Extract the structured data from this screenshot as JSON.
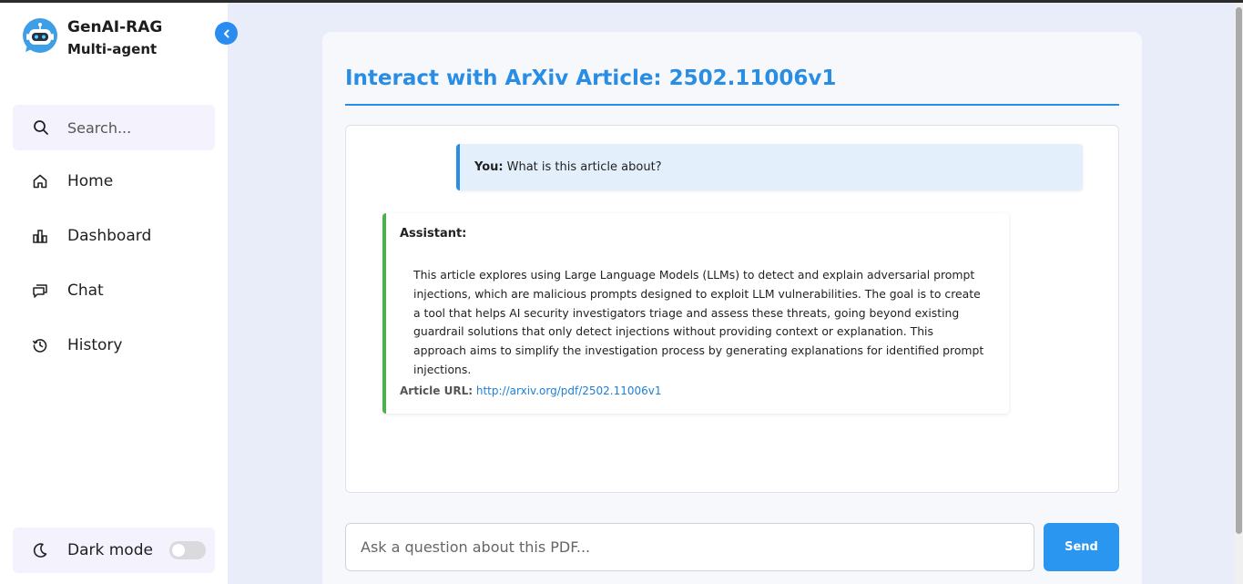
{
  "brand": {
    "name": "GenAI-RAG",
    "subtitle": "Multi-agent"
  },
  "search": {
    "placeholder": "Search..."
  },
  "nav": {
    "items": [
      {
        "label": "Home",
        "icon": "home-icon"
      },
      {
        "label": "Dashboard",
        "icon": "bar-chart-icon"
      },
      {
        "label": "Chat",
        "icon": "chat-icon"
      },
      {
        "label": "History",
        "icon": "history-icon"
      }
    ]
  },
  "darkmode": {
    "label": "Dark mode",
    "enabled": false
  },
  "main": {
    "title": "Interact with ArXiv Article: 2502.11006v1",
    "user_message": {
      "speaker": "You:",
      "text": "What is this article about?"
    },
    "assistant_message": {
      "speaker": "Assistant:",
      "text": "This article explores using Large Language Models (LLMs) to detect and explain adversarial prompt injections, which are malicious prompts designed to exploit LLM vulnerabilities.  The goal is to create a tool that helps AI security investigators triage and assess these threats, going beyond existing guardrail solutions that only detect injections without providing context or explanation.  This approach aims to simplify the investigation process by generating explanations for identified prompt injections.",
      "url_label": "Article URL:",
      "url": "http://arxiv.org/pdf/2502.11006v1"
    },
    "input_placeholder": "Ask a question about this PDF...",
    "send_label": "Send"
  },
  "colors": {
    "accent": "#2a8de4",
    "assistant_border": "#4caf50",
    "background": "#e8edf9"
  }
}
